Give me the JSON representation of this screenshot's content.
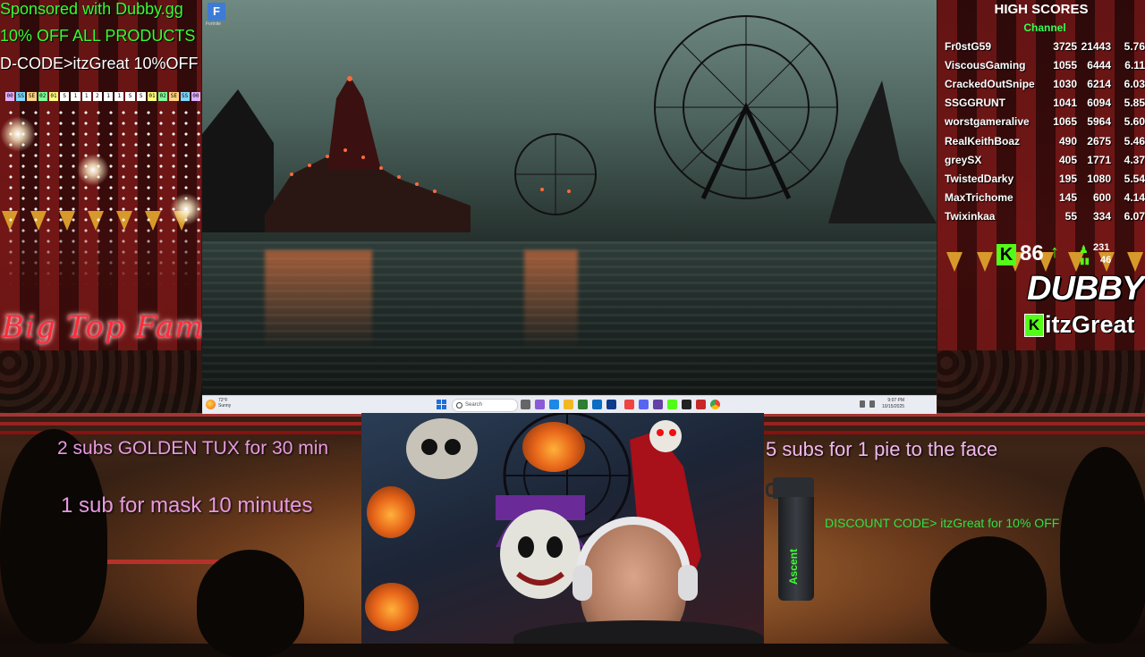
{
  "sponsor": {
    "line1": "Sponsored with Dubby.gg",
    "line2": "10% OFF ALL PRODUCTS",
    "line3": "D-CODE>itzGreat 10%OFF"
  },
  "ticker": [
    "00",
    "SS",
    "SE",
    "02",
    "01",
    "S",
    "1",
    "1",
    "2",
    "1",
    "1",
    "S",
    "S",
    "01",
    "02",
    "SE",
    "SS",
    "00"
  ],
  "title": "Big Top Fam",
  "scene": {
    "app_icon_label": "Fortnite",
    "app_icon_glyph": "F"
  },
  "taskbar": {
    "weather_line1": "72°F",
    "weather_line2": "Sunny",
    "search_placeholder": "Search",
    "clock_time": "9:07 PM",
    "clock_date": "10/15/2025"
  },
  "high_scores": {
    "title": "HIGH SCORES",
    "subtitle": "Channel",
    "rows": [
      {
        "name": "Fr0stG59",
        "a": "3725",
        "b": "21443",
        "c": "5.76"
      },
      {
        "name": "ViscousGaming",
        "a": "1055",
        "b": "6444",
        "c": "6.11"
      },
      {
        "name": "CrackedOutSnipe",
        "a": "1030",
        "b": "6214",
        "c": "6.03"
      },
      {
        "name": "SSGGRUNT",
        "a": "1041",
        "b": "6094",
        "c": "5.85"
      },
      {
        "name": "worstgameralive",
        "a": "1065",
        "b": "5964",
        "c": "5.60"
      },
      {
        "name": "RealKeithBoaz",
        "a": "490",
        "b": "2675",
        "c": "5.46"
      },
      {
        "name": "greySX",
        "a": "405",
        "b": "1771",
        "c": "4.37"
      },
      {
        "name": "TwistedDarky",
        "a": "195",
        "b": "1080",
        "c": "5.54"
      },
      {
        "name": "MaxTrichome",
        "a": "145",
        "b": "600",
        "c": "4.14"
      },
      {
        "name": "Twixinkaa",
        "a": "55",
        "b": "334",
        "c": "6.07"
      }
    ]
  },
  "kick": {
    "logo": "K",
    "viewers": "86",
    "trend": "↑",
    "followers": "231",
    "subs": "46"
  },
  "brand": {
    "logo_text": "DUBBY",
    "channel_badge": "K",
    "channel_name": "itzGreat"
  },
  "goals": {
    "tux": "2 subs GOLDEN TUX for 30 min",
    "mask": "1 sub for mask 10 minutes",
    "pie": "5 subs for 1 pie to the face",
    "discount": "DISCOUNT CODE> itzGreat for 10% OFF"
  },
  "shaker_brand": "Ascent",
  "colors": {
    "kick_green": "#53fc18",
    "goal_pink": "#e89ae0",
    "sponsor_green": "#33ff33"
  }
}
